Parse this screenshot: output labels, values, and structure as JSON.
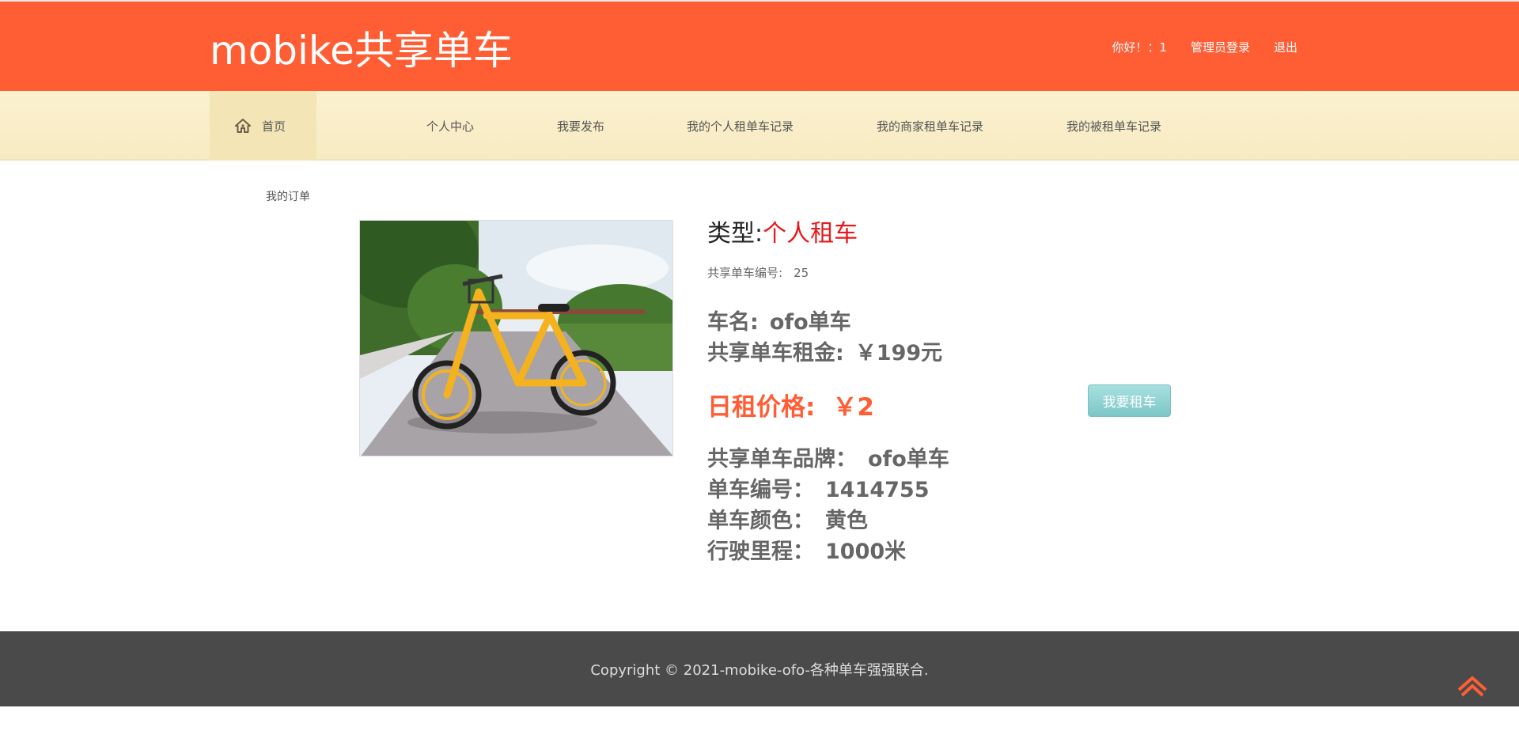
{
  "header": {
    "brand": "mobike共享单车",
    "greeting": "你好！：1",
    "admin_login": "管理员登录",
    "logout": "退出"
  },
  "nav": {
    "home": "首页",
    "items": [
      "个人中心",
      "我要发布",
      "我的个人租单车记录",
      "我的商家租单车记录",
      "我的被租单车记录"
    ]
  },
  "breadcrumb": "我的订单",
  "product": {
    "type_label": "类型:",
    "type_value": "个人租车",
    "bike_number_label": "共享单车编号:",
    "bike_number_value": "25",
    "name_label": "车名:",
    "name_value": "ofo单车",
    "deposit_label": "共享单车租金:",
    "deposit_value": "￥199元",
    "daily_label": "日租价格:",
    "daily_value": "￥2",
    "brand_label": "共享单车品牌：",
    "brand_value": "ofo单车",
    "serial_label": "单车编号：",
    "serial_value": "1414755",
    "color_label": "单车颜色：",
    "color_value": "黄色",
    "mileage_label": "行驶里程：",
    "mileage_value": "1000米"
  },
  "rent_button": "我要租车",
  "footer": {
    "copyright": "Copyright © 2021-mobike-ofo-各种单车强强联合."
  },
  "colors": {
    "header_bg": "#ff5e35",
    "accent_red": "#e8191c",
    "price_orange": "#ff5e35",
    "button_teal": "#7dc6c6",
    "footer_bg": "#4a4a4a"
  },
  "icons": {
    "home": "home-icon",
    "back_to_top": "chevron-up-icon"
  }
}
